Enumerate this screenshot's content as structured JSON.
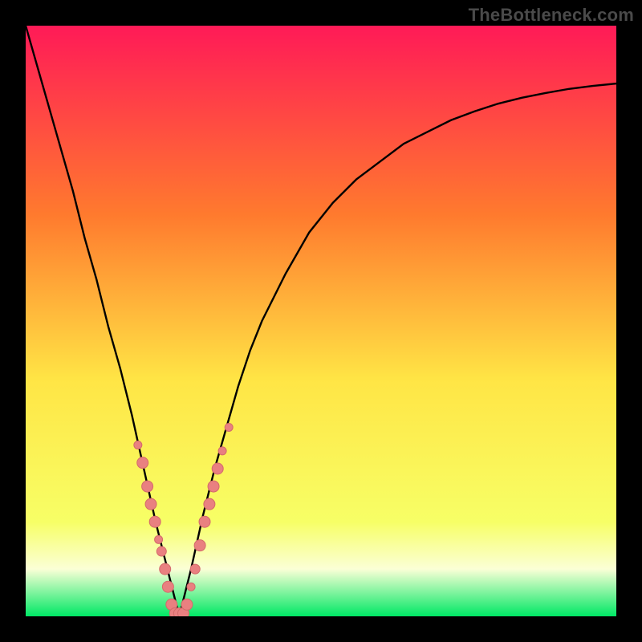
{
  "watermark": "TheBottleneck.com",
  "colors": {
    "frame": "#000000",
    "grad_top": "#ff1a57",
    "grad_mid1": "#ff7a2e",
    "grad_mid2": "#ffe545",
    "grad_low": "#f7ff66",
    "grad_white": "#fbffd6",
    "grad_green": "#00e865",
    "curve": "#000000",
    "marker_fill": "#e98080",
    "marker_stroke": "#d46a6a"
  },
  "chart_data": {
    "type": "line",
    "title": "",
    "xlabel": "",
    "ylabel": "",
    "xlim": [
      0,
      100
    ],
    "ylim": [
      0,
      100
    ],
    "series": [
      {
        "name": "curve",
        "x": [
          0,
          2,
          4,
          6,
          8,
          10,
          12,
          14,
          16,
          18,
          20,
          22,
          23,
          24,
          25,
          26,
          27,
          28,
          30,
          32,
          34,
          36,
          38,
          40,
          44,
          48,
          52,
          56,
          60,
          64,
          68,
          72,
          76,
          80,
          84,
          88,
          92,
          96,
          100
        ],
        "y": [
          100,
          93,
          86,
          79,
          72,
          64,
          57,
          49,
          42,
          34,
          25,
          16,
          12,
          8,
          4,
          0,
          4,
          8,
          17,
          25,
          32,
          39,
          45,
          50,
          58,
          65,
          70,
          74,
          77,
          80,
          82,
          84,
          85.5,
          86.8,
          87.8,
          88.6,
          89.3,
          89.8,
          90.2
        ]
      }
    ],
    "markers": {
      "name": "highlighted-points",
      "points": [
        {
          "x": 19.0,
          "y": 29,
          "r": 5
        },
        {
          "x": 19.8,
          "y": 26,
          "r": 7
        },
        {
          "x": 20.6,
          "y": 22,
          "r": 7
        },
        {
          "x": 21.2,
          "y": 19,
          "r": 7
        },
        {
          "x": 21.9,
          "y": 16,
          "r": 7
        },
        {
          "x": 22.5,
          "y": 13,
          "r": 5
        },
        {
          "x": 23.0,
          "y": 11,
          "r": 6
        },
        {
          "x": 23.6,
          "y": 8,
          "r": 7
        },
        {
          "x": 24.1,
          "y": 5,
          "r": 7
        },
        {
          "x": 24.7,
          "y": 2,
          "r": 7
        },
        {
          "x": 25.3,
          "y": 0.5,
          "r": 7
        },
        {
          "x": 26.0,
          "y": 0.5,
          "r": 7
        },
        {
          "x": 26.7,
          "y": 0.5,
          "r": 7
        },
        {
          "x": 27.3,
          "y": 2,
          "r": 7
        },
        {
          "x": 28.0,
          "y": 5,
          "r": 5
        },
        {
          "x": 28.7,
          "y": 8,
          "r": 6
        },
        {
          "x": 29.5,
          "y": 12,
          "r": 7
        },
        {
          "x": 30.3,
          "y": 16,
          "r": 7
        },
        {
          "x": 31.1,
          "y": 19,
          "r": 7
        },
        {
          "x": 31.8,
          "y": 22,
          "r": 7
        },
        {
          "x": 32.5,
          "y": 25,
          "r": 7
        },
        {
          "x": 33.3,
          "y": 28,
          "r": 5
        },
        {
          "x": 34.4,
          "y": 32,
          "r": 5
        }
      ]
    }
  }
}
